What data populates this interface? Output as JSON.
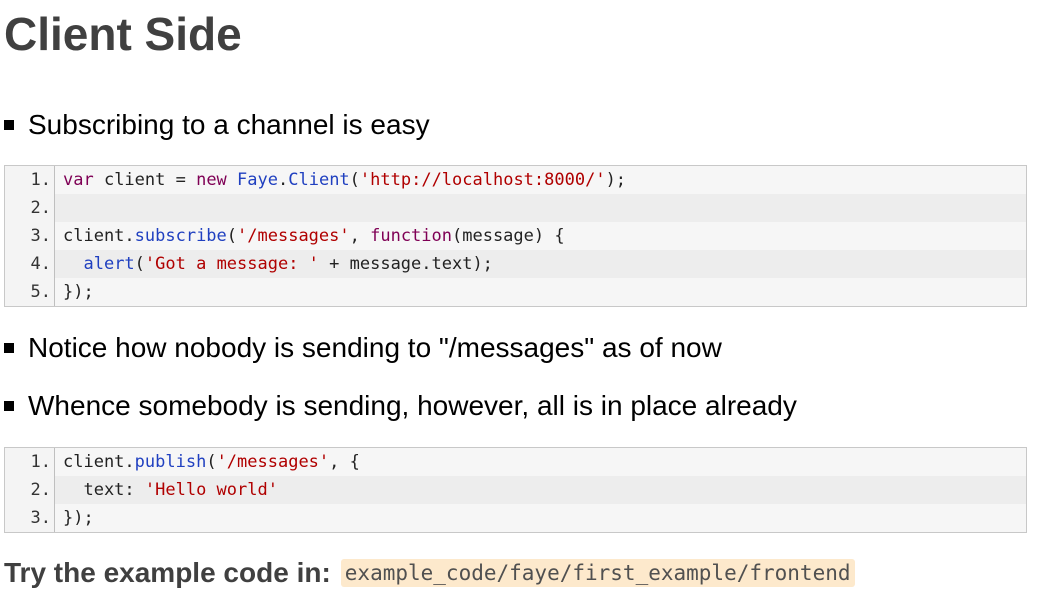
{
  "page": {
    "title": "Client Side"
  },
  "bullets": {
    "subscribe": "Subscribing to a channel is easy",
    "notice": "Notice how nobody is sending to \"/messages\" as of now",
    "whence": "Whence somebody is sending, however, all is in place already"
  },
  "code_block_1": {
    "line_numbers": [
      "1.",
      "2.",
      "3.",
      "4.",
      "5."
    ],
    "lines": [
      [
        {
          "t": "var",
          "k": "kw"
        },
        {
          "t": " client = ",
          "k": "plain"
        },
        {
          "t": "new",
          "k": "kw"
        },
        {
          "t": " ",
          "k": "plain"
        },
        {
          "t": "Faye",
          "k": "fn"
        },
        {
          "t": ".",
          "k": "plain"
        },
        {
          "t": "Client",
          "k": "fn"
        },
        {
          "t": "(",
          "k": "plain"
        },
        {
          "t": "'http://localhost:8000/'",
          "k": "str"
        },
        {
          "t": ");",
          "k": "plain"
        }
      ],
      [],
      [
        {
          "t": "client.",
          "k": "plain"
        },
        {
          "t": "subscribe",
          "k": "fn"
        },
        {
          "t": "(",
          "k": "plain"
        },
        {
          "t": "'/messages'",
          "k": "str"
        },
        {
          "t": ", ",
          "k": "plain"
        },
        {
          "t": "function",
          "k": "kw"
        },
        {
          "t": "(message) {",
          "k": "plain"
        }
      ],
      [
        {
          "t": "  ",
          "k": "plain"
        },
        {
          "t": "alert",
          "k": "fn"
        },
        {
          "t": "(",
          "k": "plain"
        },
        {
          "t": "'Got a message: '",
          "k": "str"
        },
        {
          "t": " + message.text);",
          "k": "plain"
        }
      ],
      [
        {
          "t": "});",
          "k": "plain"
        }
      ]
    ]
  },
  "code_block_2": {
    "line_numbers": [
      "1.",
      "2.",
      "3."
    ],
    "lines": [
      [
        {
          "t": "client.",
          "k": "plain"
        },
        {
          "t": "publish",
          "k": "fn"
        },
        {
          "t": "(",
          "k": "plain"
        },
        {
          "t": "'/messages'",
          "k": "str"
        },
        {
          "t": ", {",
          "k": "plain"
        }
      ],
      [
        {
          "t": "  text: ",
          "k": "plain"
        },
        {
          "t": "'Hello world'",
          "k": "str"
        }
      ],
      [
        {
          "t": "});",
          "k": "plain"
        }
      ]
    ]
  },
  "footer": {
    "label": "Try the example code in:",
    "path": "example_code/faye/first_example/frontend"
  }
}
